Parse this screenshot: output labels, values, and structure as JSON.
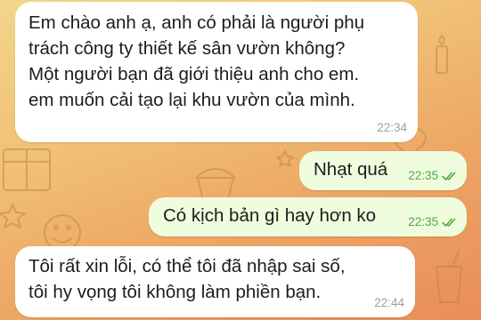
{
  "conversation": {
    "messages": [
      {
        "direction": "incoming",
        "text": "Em chào anh ạ, anh có phải là người phụ\ntrách công ty thiết kế sân vườn không?\nMột người bạn đã giới thiệu anh cho em.\nem muốn cải tạo lại khu vườn của mình.",
        "time": "22:34"
      },
      {
        "direction": "outgoing",
        "text": "Nhạt quá",
        "time": "22:35",
        "status_icon": "double-check-icon"
      },
      {
        "direction": "outgoing",
        "text": "Có kịch bản gì hay hơn ko",
        "time": "22:35",
        "status_icon": "double-check-icon"
      },
      {
        "direction": "incoming",
        "text": "Tôi rất xin lỗi, có thể tôi đã nhập sai số,\ntôi hy vọng tôi không làm phiền bạn.",
        "time": "22:44"
      }
    ]
  },
  "colors": {
    "incoming_bubble": "#ffffff",
    "outgoing_bubble": "#effdde",
    "outgoing_time": "#53a847",
    "incoming_time": "#9aa0a6"
  }
}
